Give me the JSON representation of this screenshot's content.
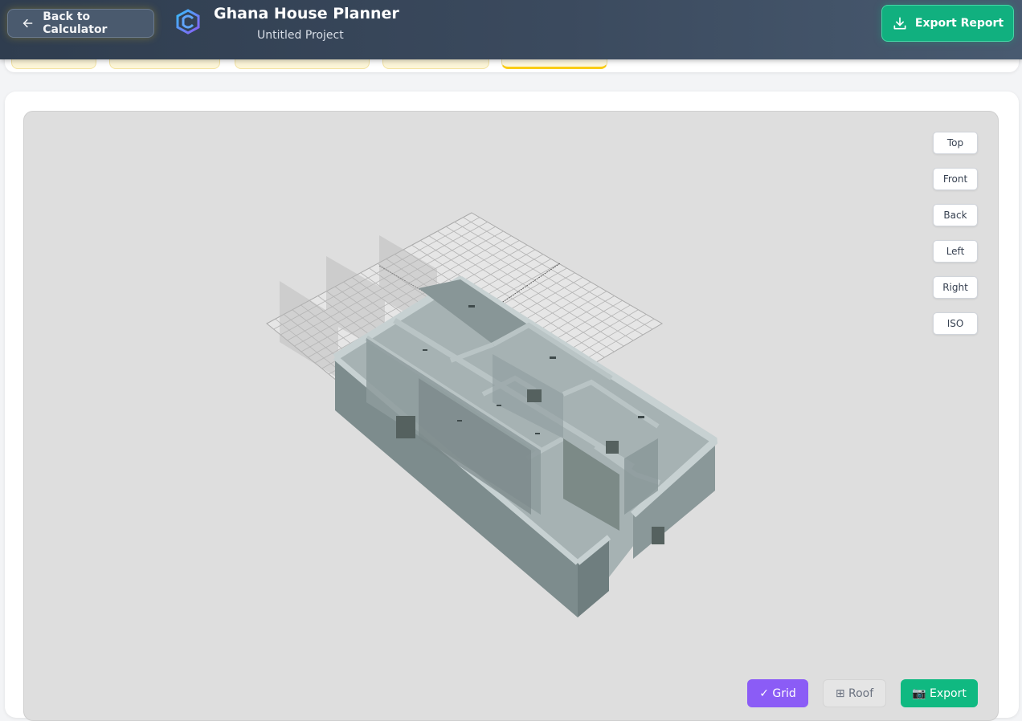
{
  "header": {
    "back_label": "Back to Calculator",
    "app_title": "Ghana House Planner",
    "project_name": "Untitled Project",
    "export_report_label": "Export Report"
  },
  "viewer": {
    "view_buttons": [
      "Top",
      "Front",
      "Back",
      "Left",
      "Right",
      "ISO"
    ],
    "toolbar": {
      "grid_label": "✓ Grid",
      "roof_label": "⊞ Roof",
      "export_label": "📷 Export"
    },
    "grid_enabled": true,
    "roof_enabled": false
  },
  "colors": {
    "header_bg": "#3b4a5e",
    "accent_green": "#10b981",
    "accent_purple": "#8b5cf6",
    "tab_highlight": "#facc15",
    "viewport_bg": "#dedede",
    "wall_color": "#8c9b9c"
  },
  "icons": {
    "back": "arrow-left-icon",
    "logo": "app-logo-icon",
    "export_report": "download-icon"
  }
}
